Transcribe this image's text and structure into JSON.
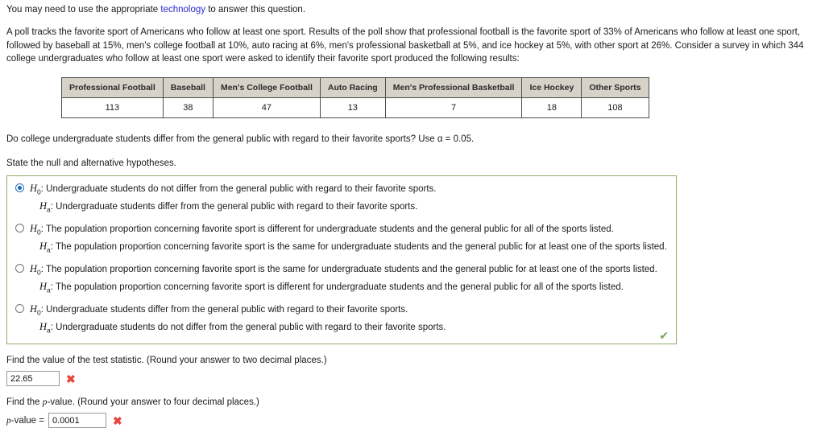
{
  "header": {
    "intro_prefix": "You may need to use the appropriate ",
    "intro_link": "technology",
    "intro_suffix": " to answer this question."
  },
  "problem": {
    "paragraph": "A poll tracks the favorite sport of Americans who follow at least one sport. Results of the poll show that professional football is the favorite sport of 33% of Americans who follow at least one sport, followed by baseball at 15%, men's college football at 10%, auto racing at 6%, men's professional basketball at 5%, and ice hockey at 5%, with other sport at 26%. Consider a survey in which 344 college undergraduates who follow at least one sport were asked to identify their favorite sport produced the following results:"
  },
  "table": {
    "headers": [
      "Professional Football",
      "Baseball",
      "Men's College Football",
      "Auto Racing",
      "Men's Professional Basketball",
      "Ice Hockey",
      "Other Sports"
    ],
    "values": [
      "113",
      "38",
      "47",
      "13",
      "7",
      "18",
      "108"
    ]
  },
  "prompts": {
    "question": "Do college undergraduate students differ from the general public with regard to their favorite sports? Use α = 0.05.",
    "state_hypotheses": "State the null and alternative hypotheses."
  },
  "options": [
    {
      "selected": true,
      "null_text": ": Undergraduate students do not differ from the general public with regard to their favorite sports.",
      "alt_text": ": Undergraduate students differ from the general public with regard to their favorite sports."
    },
    {
      "selected": false,
      "null_text": ": The population proportion concerning favorite sport is different for undergraduate students and the general public for all of the sports listed.",
      "alt_text": ": The population proportion concerning favorite sport is the same for undergraduate students and the general public for at least one of the sports listed."
    },
    {
      "selected": false,
      "null_text": ": The population proportion concerning favorite sport is the same for undergraduate students and the general public for at least one of the sports listed.",
      "alt_text": ": The population proportion concerning favorite sport is different for undergraduate students and the general public for all of the sports listed."
    },
    {
      "selected": false,
      "null_text": ": Undergraduate students differ from the general public with regard to their favorite sports.",
      "alt_text": ": Undergraduate students do not differ from the general public with regard to their favorite sports."
    }
  ],
  "status": {
    "option_box_mark": "✔",
    "wrong_mark": "✖"
  },
  "answers": {
    "test_statistic_label": "Find the value of the test statistic. (Round your answer to two decimal places.)",
    "test_statistic_value": "22.65",
    "test_statistic_placeholder": "",
    "p_value_label": "Find the p-value. (Round your answer to four decimal places.)",
    "p_value_prefix": "p",
    "p_value_suffix": "-value  =",
    "p_value_value": "0.0001",
    "p_value_placeholder": ""
  },
  "symbols": {
    "h_letter": "H",
    "null_sub": "0",
    "alt_sub": "a"
  }
}
